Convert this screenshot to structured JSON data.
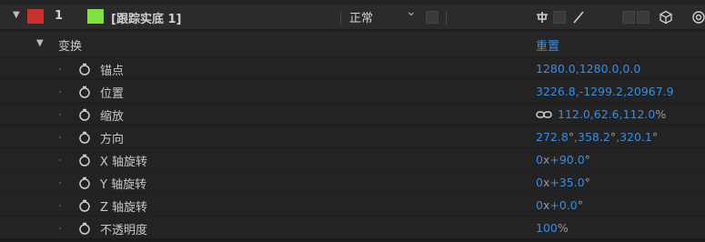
{
  "layer": {
    "expand_glyph": "▼",
    "label_color": "#c8312c",
    "number": "1",
    "color_swatch": "#7fe13c",
    "name": "[跟踪实底 1]",
    "blend_mode": "正常",
    "blend_chevron": "⌄"
  },
  "transform": {
    "expand_glyph": "▼",
    "label": "变换",
    "reset": "重置"
  },
  "properties": [
    {
      "label": "锚点",
      "value": "1280.0,1280.0,0.0",
      "has_link": false
    },
    {
      "label": "位置",
      "value": "3226.8,-1299.2,20967.9",
      "has_link": false
    },
    {
      "label": "缩放",
      "value": "112.0,62.6,112.0",
      "unit": "%",
      "has_link": true
    },
    {
      "label": "方向",
      "v1": "272.8",
      "v2": "358.2",
      "v3": "320.1",
      "deg": "°",
      "has_link": false
    },
    {
      "label": "X 轴旋转",
      "turns": "0",
      "x": "x",
      "angle": "+90.0",
      "deg": "°"
    },
    {
      "label": "Y 轴旋转",
      "turns": "0",
      "x": "x",
      "angle": "+35.0",
      "deg": "°"
    },
    {
      "label": "Z 轴旋转",
      "turns": "0",
      "x": "x",
      "angle": "+0.0",
      "deg": "°"
    },
    {
      "label": "不透明度",
      "value": "100",
      "unit": "%"
    }
  ],
  "colors": {
    "value_blue": "#3b8de0",
    "background": "#232323"
  }
}
